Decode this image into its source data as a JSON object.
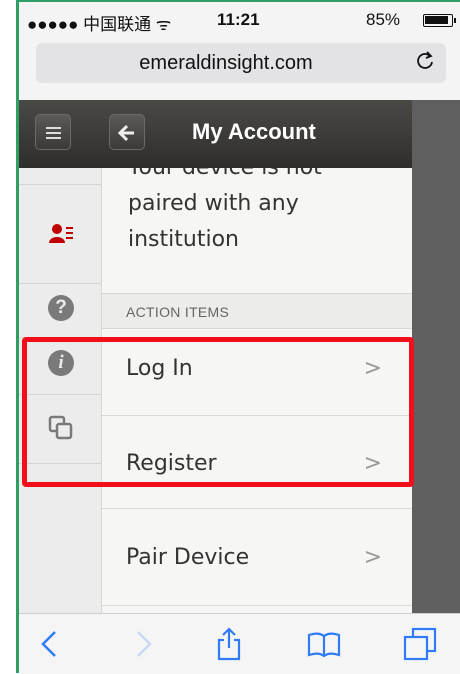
{
  "status_bar": {
    "carrier": "●●●●● 中国联通 ᯤ",
    "time": "11:21",
    "battery_percent": "85%"
  },
  "browser": {
    "url": "emeraldinsight.com",
    "reload_icon": "reload-icon"
  },
  "header": {
    "title": "My Account",
    "menu_icon": "hamburger-icon",
    "back_icon": "back-arrow-icon"
  },
  "sidebar_icons": [
    "partial-icon",
    "user-card-icon",
    "help-icon",
    "info-icon",
    "copy-icon"
  ],
  "content": {
    "pairing_message": "Your device is not paired with any institution",
    "section_header": "ACTION ITEMS",
    "items": [
      {
        "label": "Log In",
        "chevron": ">"
      },
      {
        "label": "Register",
        "chevron": ">"
      },
      {
        "label": "Pair Device",
        "chevron": ">"
      }
    ]
  },
  "help_glyph": "?",
  "info_glyph": "i",
  "toolbar": {
    "icons": [
      "back-chevron-icon",
      "forward-chevron-icon",
      "share-icon",
      "bookmarks-icon",
      "tabs-icon"
    ]
  },
  "colors": {
    "accent": "#2f7cf6",
    "highlight": "#f20f1b",
    "header_bg": "#3a3937",
    "user_icon": "#c00000"
  }
}
